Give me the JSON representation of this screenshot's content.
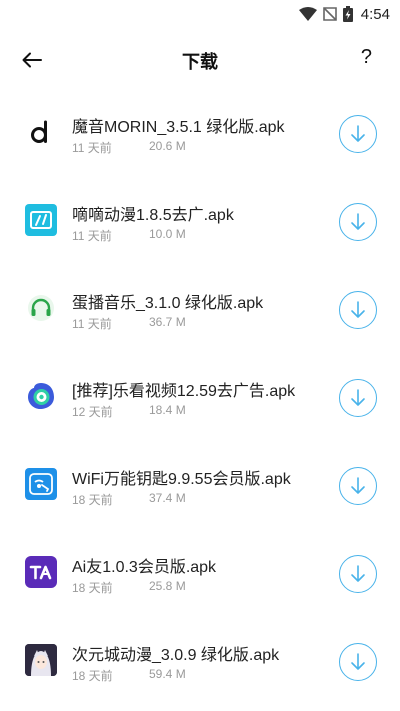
{
  "status_bar": {
    "time": "4:54"
  },
  "header": {
    "title": "下载",
    "help_label": "?"
  },
  "colors": {
    "accent": "#49b3ea",
    "meta_text": "#9a9a9a"
  },
  "downloads": [
    {
      "name": "魔音MORIN_3.5.1 绿化版.apk",
      "age": "11 天前",
      "size": "20.6 M",
      "icon": "morin-d-logo-icon"
    },
    {
      "name": "嘀嘀动漫1.8.5去广.apk",
      "age": "11 天前",
      "size": "10.0 M",
      "icon": "didi-anime-logo-icon"
    },
    {
      "name": "蛋播音乐_3.1.0 绿化版.apk",
      "age": "11 天前",
      "size": "36.7 M",
      "icon": "headphones-logo-icon"
    },
    {
      "name": "[推荐]乐看视频12.59去广告.apk",
      "age": "12 天前",
      "size": "18.4 M",
      "icon": "film-reel-logo-icon"
    },
    {
      "name": "WiFi万能钥匙9.9.55会员版.apk",
      "age": "18 天前",
      "size": "37.4 M",
      "icon": "wifi-key-logo-icon"
    },
    {
      "name": "Ai友1.0.3会员版.apk",
      "age": "18 天前",
      "size": "25.8 M",
      "icon": "ta-logo-icon"
    },
    {
      "name": "次元城动漫_3.0.9 绿化版.apk",
      "age": "18 天前",
      "size": "59.4 M",
      "icon": "anime-character-logo-icon"
    }
  ]
}
